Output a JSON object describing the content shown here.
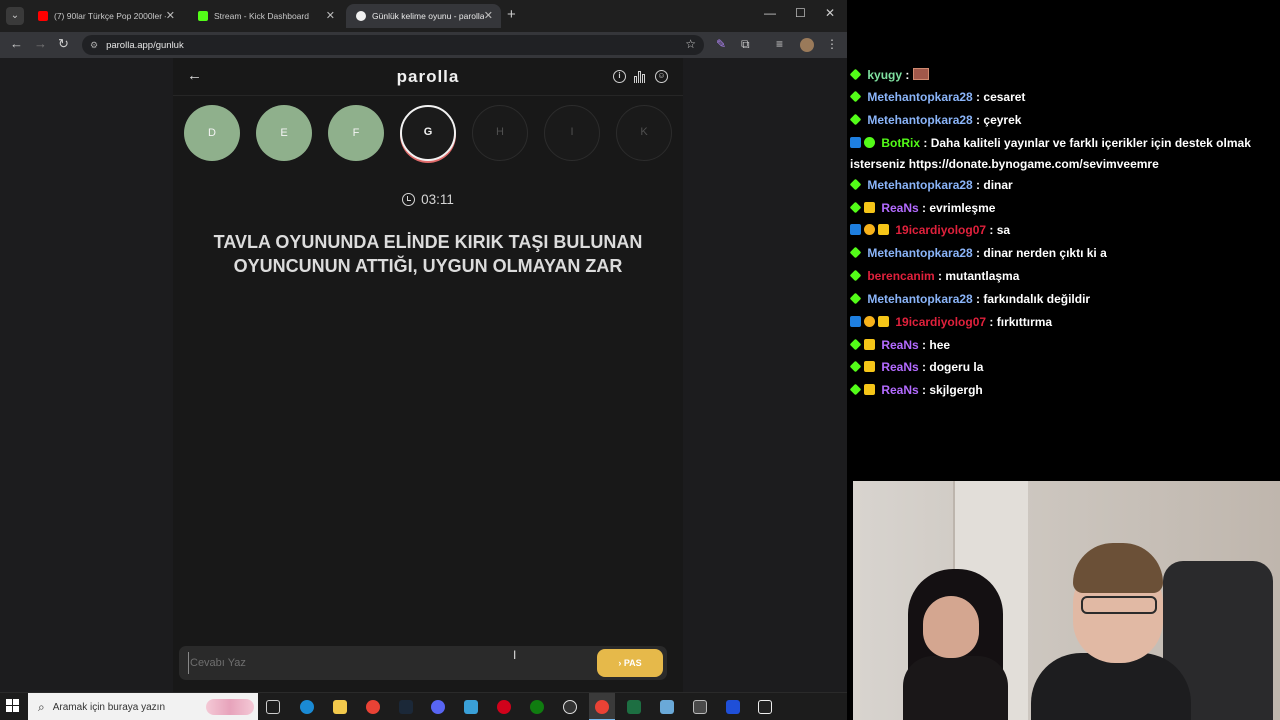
{
  "browser": {
    "tab_list_icon": "chevron-down-icon",
    "tabs": [
      {
        "title": "(7) 90lar Türkçe Pop 2000ler - Y",
        "favicon_color": "#ff0000",
        "active": false
      },
      {
        "title": "Stream - Kick Dashboard",
        "favicon_color": "#53fc18",
        "active": false
      },
      {
        "title": "Günlük kelime oyunu - parolla",
        "favicon_color": "#f0f0f0",
        "active": true
      }
    ],
    "url": "parolla.app/gunluk"
  },
  "app": {
    "logo": "parolla",
    "letters": [
      {
        "char": "D",
        "state": "done"
      },
      {
        "char": "E",
        "state": "done"
      },
      {
        "char": "F",
        "state": "done"
      },
      {
        "char": "G",
        "state": "current"
      },
      {
        "char": "H",
        "state": "todo"
      },
      {
        "char": "I",
        "state": "todo"
      },
      {
        "char": "K",
        "state": "todo"
      }
    ],
    "timer": "03:11",
    "question": "TAVLA OYUNUNDA ELİNDE KIRIK TAŞI BULUNAN OYUNCUNUN ATTIĞI, UYGUN OLMAYAN ZAR",
    "answer_placeholder": "Cevabı Yaz",
    "pass_label": "PAS",
    "colors": {
      "done": "#8fb08c",
      "pass_button": "#e6b94a"
    }
  },
  "taskbar": {
    "search_placeholder": "Aramak için buraya yazın"
  },
  "chat": {
    "messages": [
      {
        "user": "kyugy",
        "user_color": "#7fe0a0",
        "badges": [
          "green"
        ],
        "text": "",
        "emote": true
      },
      {
        "user": "Metehantopkara28",
        "user_color": "#8ab4f8",
        "badges": [
          "green"
        ],
        "text": "cesaret"
      },
      {
        "user": "Metehantopkara28",
        "user_color": "#8ab4f8",
        "badges": [
          "green"
        ],
        "text": "çeyrek"
      },
      {
        "user": "BotRix",
        "user_color": "#53fc18",
        "badges": [
          "blue",
          "verified"
        ],
        "text": "Daha kaliteli yayınlar ve farklı içerikler için destek olmak isterseniz https://donate.bynogame.com/sevimveemre"
      },
      {
        "user": "Metehantopkara28",
        "user_color": "#8ab4f8",
        "badges": [
          "green"
        ],
        "text": "dinar"
      },
      {
        "user": "ReaNs",
        "user_color": "#b36bff",
        "badges": [
          "green",
          "crown"
        ],
        "text": "evrimleşme"
      },
      {
        "user": "19icardiyolog07",
        "user_color": "#e0213c",
        "badges": [
          "blue",
          "orange",
          "crown"
        ],
        "text": "sa"
      },
      {
        "user": "Metehantopkara28",
        "user_color": "#8ab4f8",
        "badges": [
          "green"
        ],
        "text": "dinar nerden çıktı ki a"
      },
      {
        "user": "berencanim",
        "user_color": "#e0213c",
        "badges": [
          "green"
        ],
        "text": "mutantlaşma"
      },
      {
        "user": "Metehantopkara28",
        "user_color": "#8ab4f8",
        "badges": [
          "green"
        ],
        "text": "farkındalık değildir"
      },
      {
        "user": "19icardiyolog07",
        "user_color": "#e0213c",
        "badges": [
          "blue",
          "orange",
          "crown"
        ],
        "text": "fırkıttırma"
      },
      {
        "user": "ReaNs",
        "user_color": "#b36bff",
        "badges": [
          "green",
          "crown"
        ],
        "text": "hee"
      },
      {
        "user": "ReaNs",
        "user_color": "#b36bff",
        "badges": [
          "green",
          "crown"
        ],
        "text": "dogeru la"
      },
      {
        "user": "ReaNs",
        "user_color": "#b36bff",
        "badges": [
          "green",
          "crown"
        ],
        "text": "skjlgergh"
      }
    ]
  }
}
